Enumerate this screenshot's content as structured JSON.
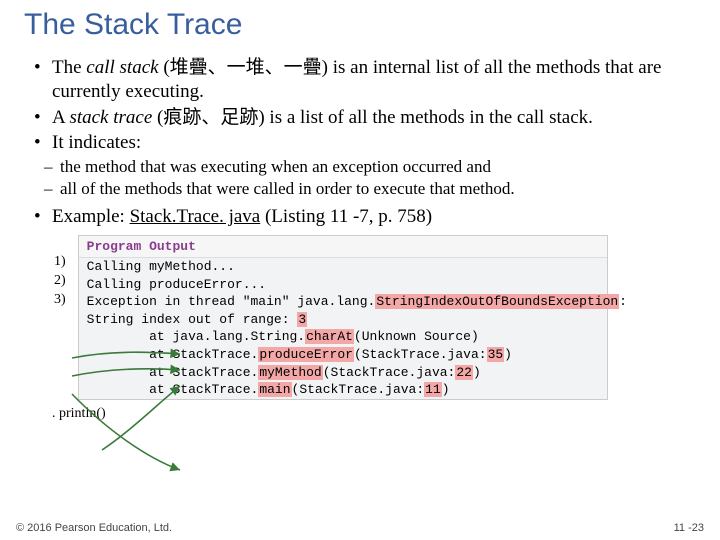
{
  "title": "The Stack Trace",
  "bullets": {
    "b1_pre": "The ",
    "b1_em": "call stack",
    "b1_post": " (堆疊、一堆、一疊) is an internal list of all the methods that are currently executing.",
    "b2_pre": "A ",
    "b2_em": "stack trace",
    "b2_post": " (痕跡、足跡) is a list of all the methods in the call stack.",
    "b3": "It indicates:",
    "d1": "the method that was executing when an exception occurred and",
    "d2": "all of the methods that were called in order to execute that method.",
    "b4_pre": "Example: ",
    "b4_link": "Stack.Trace. java",
    "b4_post": " (Listing 11 -7, p. 758)"
  },
  "nums": {
    "n1": "1)",
    "n2": "2)",
    "n3": "3)"
  },
  "println_label": ". println()",
  "code": {
    "header": "Program Output",
    "l1": "Calling myMethod...",
    "l2": "Calling produceError...",
    "l3_a": "Exception in thread \"main\" java.lang.",
    "l3_b": "StringIndexOutOfBoundsException",
    "l3_c": ":",
    "l4_a": "String index out of range: ",
    "l4_b": "3",
    "l5_a": "        at java.lang.String.",
    "l5_b": "charAt",
    "l5_c": "(Unknown Source)",
    "l6_a": "        at StackTrace.",
    "l6_b": "produceError",
    "l6_c": "(StackTrace.java:",
    "l6_d": "35",
    "l6_e": ")",
    "l7_a": "        at StackTrace.",
    "l7_b": "myMethod",
    "l7_c": "(StackTrace.java:",
    "l7_d": "22",
    "l7_e": ")",
    "l8_a": "        at StackTrace.",
    "l8_b": "main",
    "l8_c": "(StackTrace.java:",
    "l8_d": "11",
    "l8_e": ")"
  },
  "footer": {
    "left": "© 2016 Pearson Education, Ltd.",
    "right": "11 -23"
  }
}
